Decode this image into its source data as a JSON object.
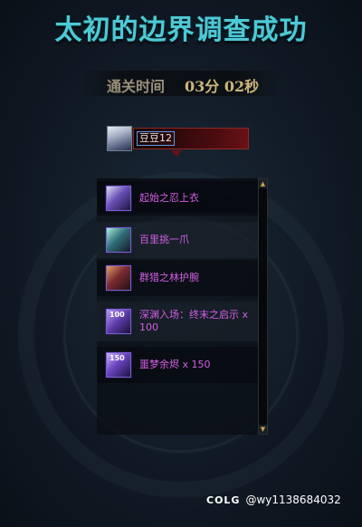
{
  "title": "太初的边界调查成功",
  "clear_time": {
    "label": "通关时间",
    "value": "03分 02秒"
  },
  "player": {
    "name": "豆豆12"
  },
  "rewards": [
    {
      "name": "起始之忍上衣",
      "icon": "cloth-armor-icon",
      "qty": ""
    },
    {
      "name": "百里挑一爪",
      "icon": "claw-weapon-icon",
      "qty": ""
    },
    {
      "name": "群猎之林护腕",
      "icon": "bracer-icon",
      "qty": ""
    },
    {
      "name": "深渊入场：终末之启示 x 100",
      "icon": "abyss-ticket-icon",
      "qty": "100"
    },
    {
      "name": "噩梦余烬 x 150",
      "icon": "nightmare-ember-icon",
      "qty": "150"
    }
  ],
  "scroll": {
    "up": "▲",
    "down": "▼"
  },
  "watermark": {
    "logo": "COLG",
    "user": "@wy1138684032"
  },
  "colors": {
    "title": "#4ec9d6",
    "item_name": "#d45fe6",
    "time_value": "#cdb578"
  }
}
